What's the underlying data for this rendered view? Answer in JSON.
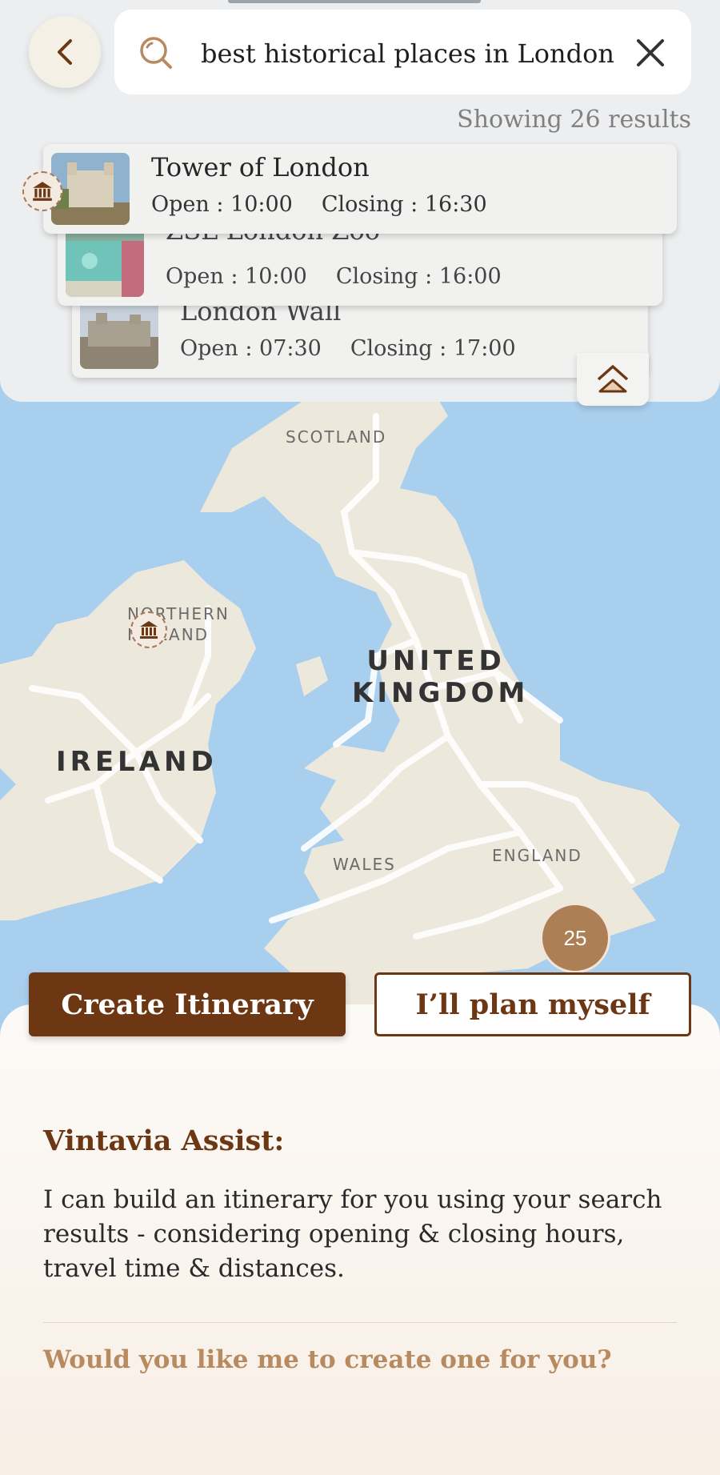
{
  "search": {
    "query": "best historical places in London",
    "results_count": "Showing 26 results"
  },
  "results": [
    {
      "name": "Tower of London",
      "open": "Open : 10:00",
      "closing": "Closing : 16:30"
    },
    {
      "name": "ZSL London Zoo",
      "open": "Open : 10:00",
      "closing": "Closing : 16:00"
    },
    {
      "name": "London Wall",
      "open": "Open : 07:30",
      "closing": "Closing : 17:00"
    }
  ],
  "map": {
    "labels": {
      "scotland": "SCOTLAND",
      "northern_ireland_1": "NORTHERN",
      "northern_ireland_2": "IRELAND",
      "united_kingdom_1": "UNITED",
      "united_kingdom_2": "KINGDOM",
      "ireland": "IRELAND",
      "wales": "WALES",
      "england": "ENGLAND"
    },
    "cluster_count": "25"
  },
  "actions": {
    "create": "Create Itinerary",
    "plan": "I’ll plan myself"
  },
  "assist": {
    "title": "Vintavia Assist:",
    "body": "I can build an itinerary for you using your search results - considering opening & closing hours, travel time & distances.",
    "question": "Would you like me to create one for you?"
  },
  "colors": {
    "brand": "#6d3714",
    "accent": "#b88a60",
    "sea": "#a9cfee",
    "land": "#ede8dc"
  },
  "icons": {
    "back": "chevron-left-icon",
    "search": "search-icon",
    "clear": "close-icon",
    "collapse": "double-chevron-up-icon",
    "marker": "museum-icon"
  }
}
